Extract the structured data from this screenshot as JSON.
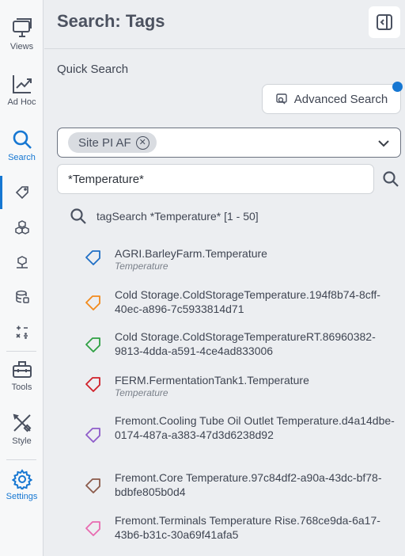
{
  "nav": {
    "views": "Views",
    "adhoc": "Ad Hoc",
    "search": "Search",
    "tools": "Tools",
    "style": "Style",
    "settings": "Settings"
  },
  "header": {
    "title": "Search: Tags"
  },
  "quick_search": {
    "label": "Quick Search",
    "advanced_button": "Advanced Search",
    "scope_chip": "Site PI AF",
    "query_value": "*Temperature*",
    "result_summary": "tagSearch *Temperature* [1 - 50]"
  },
  "results": [
    {
      "name": "AGRI.BarleyFarm.Temperature",
      "sub": "Temperature",
      "color": "#1f6fc5"
    },
    {
      "name": "Cold Storage.ColdStorageTemperature.194f8b74-8cff-40ec-a896-7c5933814d71",
      "sub": "",
      "color": "#f28a1c"
    },
    {
      "name": "Cold Storage.ColdStorageTemperatureRT.86960382-9813-4dda-a591-4ce4ad833006",
      "sub": "",
      "color": "#2ea043"
    },
    {
      "name": "FERM.FermentationTank1.Temperature",
      "sub": "Temperature",
      "color": "#d0202a"
    },
    {
      "name": "Fremont.Cooling Tube Oil Outlet Temperature.d4a14dbe-0174-487a-a383-47d3d6238d92",
      "sub": "",
      "color": "#8e5cc9"
    },
    {
      "name": "Fremont.Core Temperature.97c84df2-a90a-43dc-bf78-bdbfe805b0d4",
      "sub": "",
      "color": "#8b5a4a"
    },
    {
      "name": "Fremont.Terminals Temperature Rise.768ce9da-6a17-43b6-b31c-30a69f41afa5",
      "sub": "",
      "color": "#e86bb0"
    }
  ]
}
